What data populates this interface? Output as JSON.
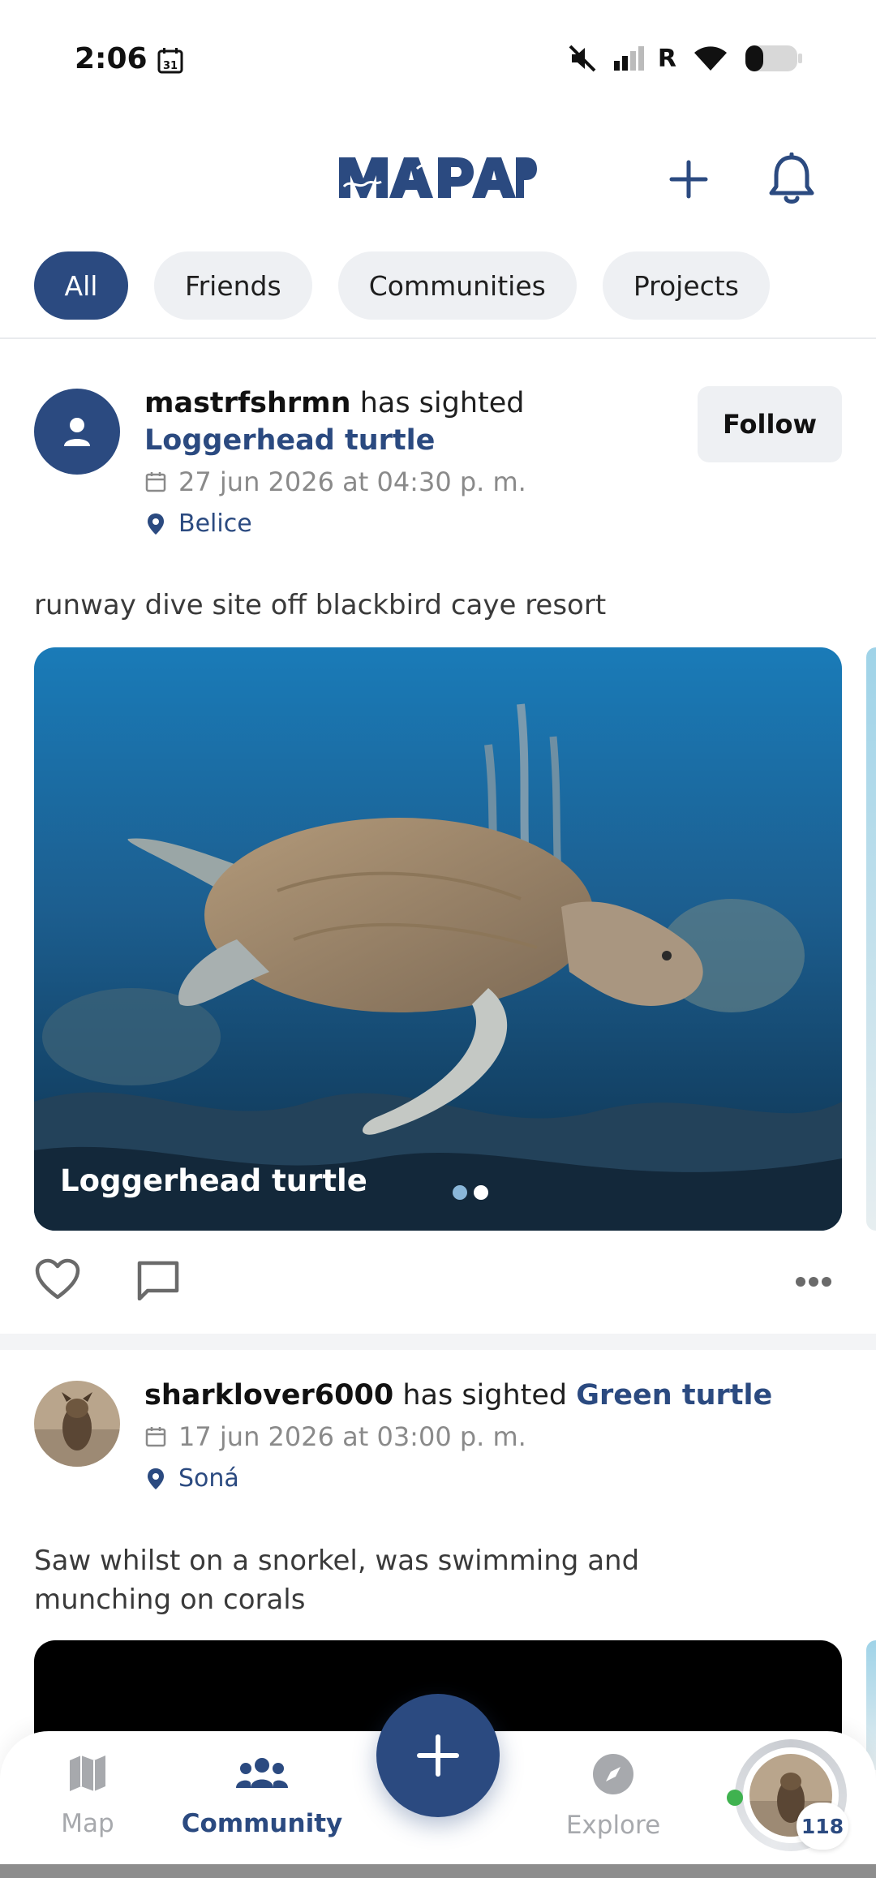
{
  "status_bar": {
    "time": "2:06",
    "calendar_day": "31",
    "signal_label": "R"
  },
  "header": {
    "logo_text": "MAPAP",
    "colors": {
      "brand": "#2b4a80"
    }
  },
  "filters": [
    {
      "label": "All",
      "active": true
    },
    {
      "label": "Friends",
      "active": false
    },
    {
      "label": "Communities",
      "active": false
    },
    {
      "label": "Projects",
      "active": false
    }
  ],
  "posts": [
    {
      "username": "mastrfshrmn",
      "action_text": "has sighted",
      "species": "Loggerhead turtle",
      "date": "27 jun 2026 at 04:30 p. m.",
      "location": "Belice",
      "follow_label": "Follow",
      "caption": "runway dive site off blackbird caye resort",
      "photo_label": "Loggerhead turtle",
      "photo_count": 2,
      "photo_active_index": 0
    },
    {
      "username": "sharklover6000",
      "action_text": "has sighted",
      "species": "Green turtle",
      "date": "17 jun 2026 at 03:00 p. m.",
      "location": "Soná",
      "caption": "Saw whilst on a snorkel, was swimming and munching on corals"
    }
  ],
  "bottom_nav": {
    "items": [
      {
        "label": "Map",
        "icon": "map-icon",
        "active": false
      },
      {
        "label": "Community",
        "icon": "people-icon",
        "active": true
      },
      {
        "label": "Explore",
        "icon": "compass-icon",
        "active": false
      }
    ],
    "profile_badge": "118"
  }
}
